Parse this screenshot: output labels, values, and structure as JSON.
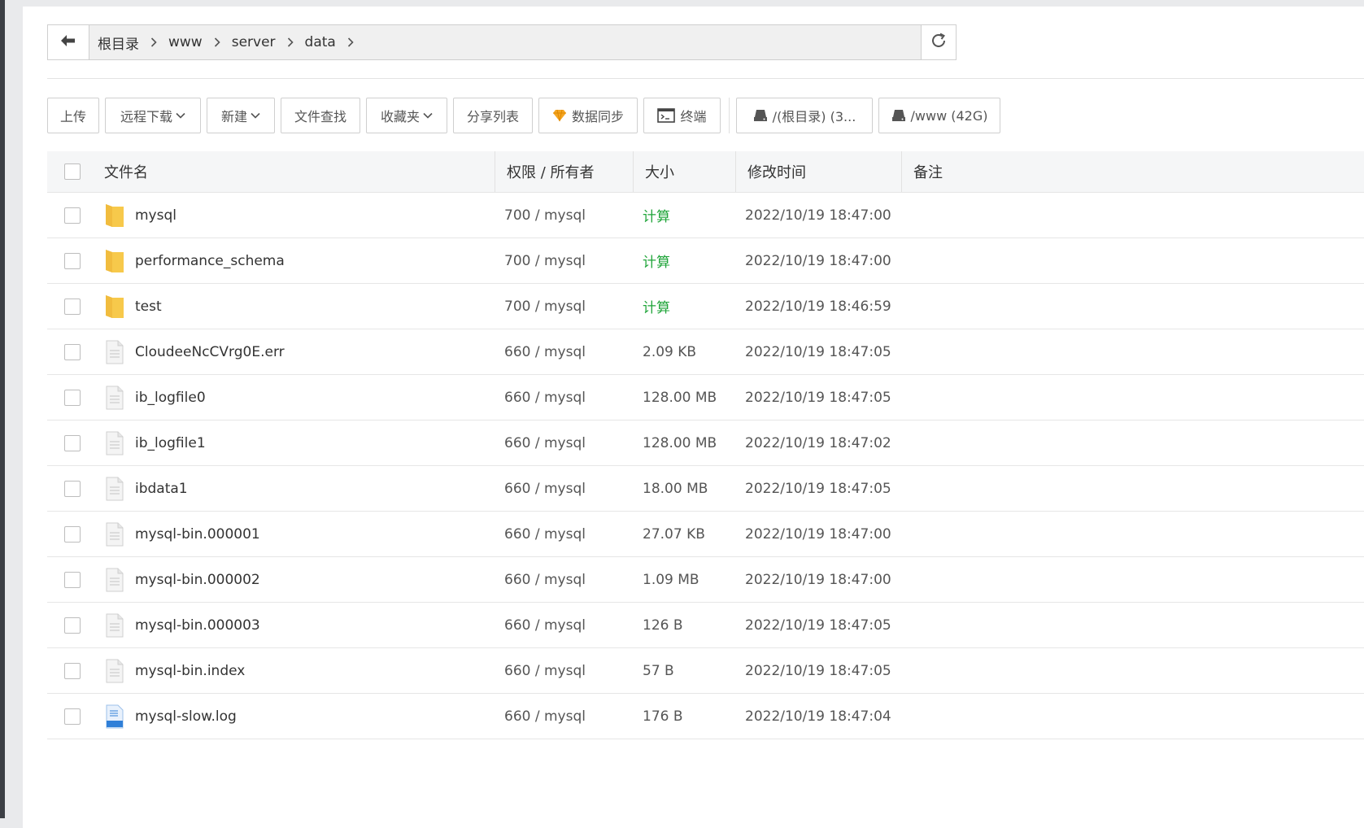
{
  "pathbar": {
    "crumbs": [
      "根目录",
      "www",
      "server",
      "data"
    ]
  },
  "toolbar": {
    "upload": "上传",
    "remote_download": "远程下载",
    "new": "新建",
    "file_search": "文件查找",
    "favorites": "收藏夹",
    "share_list": "分享列表",
    "data_sync": "数据同步",
    "terminal": "终端",
    "disk_root": "/(根目录) (3...",
    "disk_www": "/www (42G)"
  },
  "table": {
    "headers": {
      "name": "文件名",
      "perm": "权限 / 所有者",
      "size": "大小",
      "mtime": "修改时间",
      "note": "备注"
    },
    "rows": [
      {
        "type": "folder",
        "name": "mysql",
        "perm": "700 / mysql",
        "size": "计算",
        "mtime": "2022/10/19 18:47:00"
      },
      {
        "type": "folder",
        "name": "performance_schema",
        "perm": "700 / mysql",
        "size": "计算",
        "mtime": "2022/10/19 18:47:00"
      },
      {
        "type": "folder",
        "name": "test",
        "perm": "700 / mysql",
        "size": "计算",
        "mtime": "2022/10/19 18:46:59"
      },
      {
        "type": "file",
        "name": "CloudeeNcCVrg0E.err",
        "perm": "660 / mysql",
        "size": "2.09 KB",
        "mtime": "2022/10/19 18:47:05"
      },
      {
        "type": "file",
        "name": "ib_logfile0",
        "perm": "660 / mysql",
        "size": "128.00 MB",
        "mtime": "2022/10/19 18:47:05"
      },
      {
        "type": "file",
        "name": "ib_logfile1",
        "perm": "660 / mysql",
        "size": "128.00 MB",
        "mtime": "2022/10/19 18:47:02"
      },
      {
        "type": "file",
        "name": "ibdata1",
        "perm": "660 / mysql",
        "size": "18.00 MB",
        "mtime": "2022/10/19 18:47:05"
      },
      {
        "type": "file",
        "name": "mysql-bin.000001",
        "perm": "660 / mysql",
        "size": "27.07 KB",
        "mtime": "2022/10/19 18:47:00"
      },
      {
        "type": "file",
        "name": "mysql-bin.000002",
        "perm": "660 / mysql",
        "size": "1.09 MB",
        "mtime": "2022/10/19 18:47:00"
      },
      {
        "type": "file",
        "name": "mysql-bin.000003",
        "perm": "660 / mysql",
        "size": "126 B",
        "mtime": "2022/10/19 18:47:05"
      },
      {
        "type": "file",
        "name": "mysql-bin.index",
        "perm": "660 / mysql",
        "size": "57 B",
        "mtime": "2022/10/19 18:47:05"
      },
      {
        "type": "log",
        "name": "mysql-slow.log",
        "perm": "660 / mysql",
        "size": "176 B",
        "mtime": "2022/10/19 18:47:04"
      }
    ]
  },
  "colors": {
    "calc_green": "#20a53a",
    "folder_yellow": "#f7c94b",
    "log_blue": "#2f7fd8"
  },
  "icons": {
    "back": "arrow-left-icon",
    "refresh": "refresh-icon",
    "crumb_sep": "chevron-right-icon",
    "caret": "chevron-down-icon",
    "data_sync": "diamond-icon",
    "terminal": "terminal-icon",
    "disk": "disk-icon",
    "folder": "folder-icon",
    "file": "file-icon",
    "log": "log-file-icon"
  }
}
